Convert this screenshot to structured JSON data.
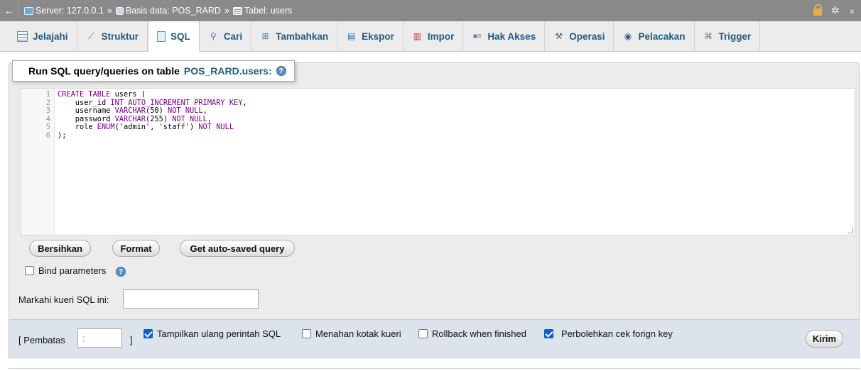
{
  "breadcrumb": {
    "back_arrow": "←",
    "server": "Server: 127.0.0.1",
    "separator": "»",
    "database": "Basis data: POS_RARD",
    "table": "Tabel: users"
  },
  "tabs": [
    {
      "label": "Jelajahi",
      "icon": "table-browse-icon"
    },
    {
      "label": "Struktur",
      "icon": "structure-icon"
    },
    {
      "label": "SQL",
      "icon": "sql-document-icon",
      "active": true
    },
    {
      "label": "Cari",
      "icon": "search-icon"
    },
    {
      "label": "Tambahkan",
      "icon": "insert-icon"
    },
    {
      "label": "Ekspor",
      "icon": "export-icon"
    },
    {
      "label": "Impor",
      "icon": "import-icon"
    },
    {
      "label": "Hak Akses",
      "icon": "privileges-icon"
    },
    {
      "label": "Operasi",
      "icon": "wrench-icon"
    },
    {
      "label": "Pelacakan",
      "icon": "eye-icon"
    },
    {
      "label": "Trigger",
      "icon": "trigger-icon"
    }
  ],
  "query_panel": {
    "legend_prefix": "Run SQL query/queries on table",
    "legend_table": "POS_RARD.users:",
    "help_glyph": "?"
  },
  "editor": {
    "line_numbers": [
      "1",
      "2",
      "3",
      "4",
      "5",
      "6"
    ],
    "lines": [
      {
        "text": "CREATE TABLE users ("
      },
      {
        "text": "    user_id INT AUTO_INCREMENT PRIMARY KEY,"
      },
      {
        "text": "    username VARCHAR(50) NOT NULL,"
      },
      {
        "text": "    password VARCHAR(255) NOT NULL,"
      },
      {
        "text": "    role ENUM('admin', 'staff') NOT NULL"
      },
      {
        "text": ");"
      }
    ]
  },
  "buttons": {
    "clear": "Bersihkan",
    "format": "Format",
    "auto_saved": "Get auto-saved query",
    "submit": "Kirim"
  },
  "options": {
    "bind_parameters": "Bind parameters",
    "bookmark_label": "Markahi kueri SQL ini:",
    "delimiter_open": "[ Pembatas",
    "delimiter_value": ";",
    "delimiter_close": "]",
    "show_query": "Tampilkan ulang perintah SQL",
    "retain_box": "Menahan kotak kueri",
    "rollback": "Rollback when finished",
    "foreign_key": "Perbolehkan cek forign key"
  },
  "checkbox_state": {
    "bind_parameters": false,
    "show_query": true,
    "retain_box": false,
    "rollback": false,
    "foreign_key": true
  },
  "colors": {
    "link": "#235a81",
    "checkbox_on": "#0b5dd7",
    "topbar": "#8a8a8a"
  }
}
